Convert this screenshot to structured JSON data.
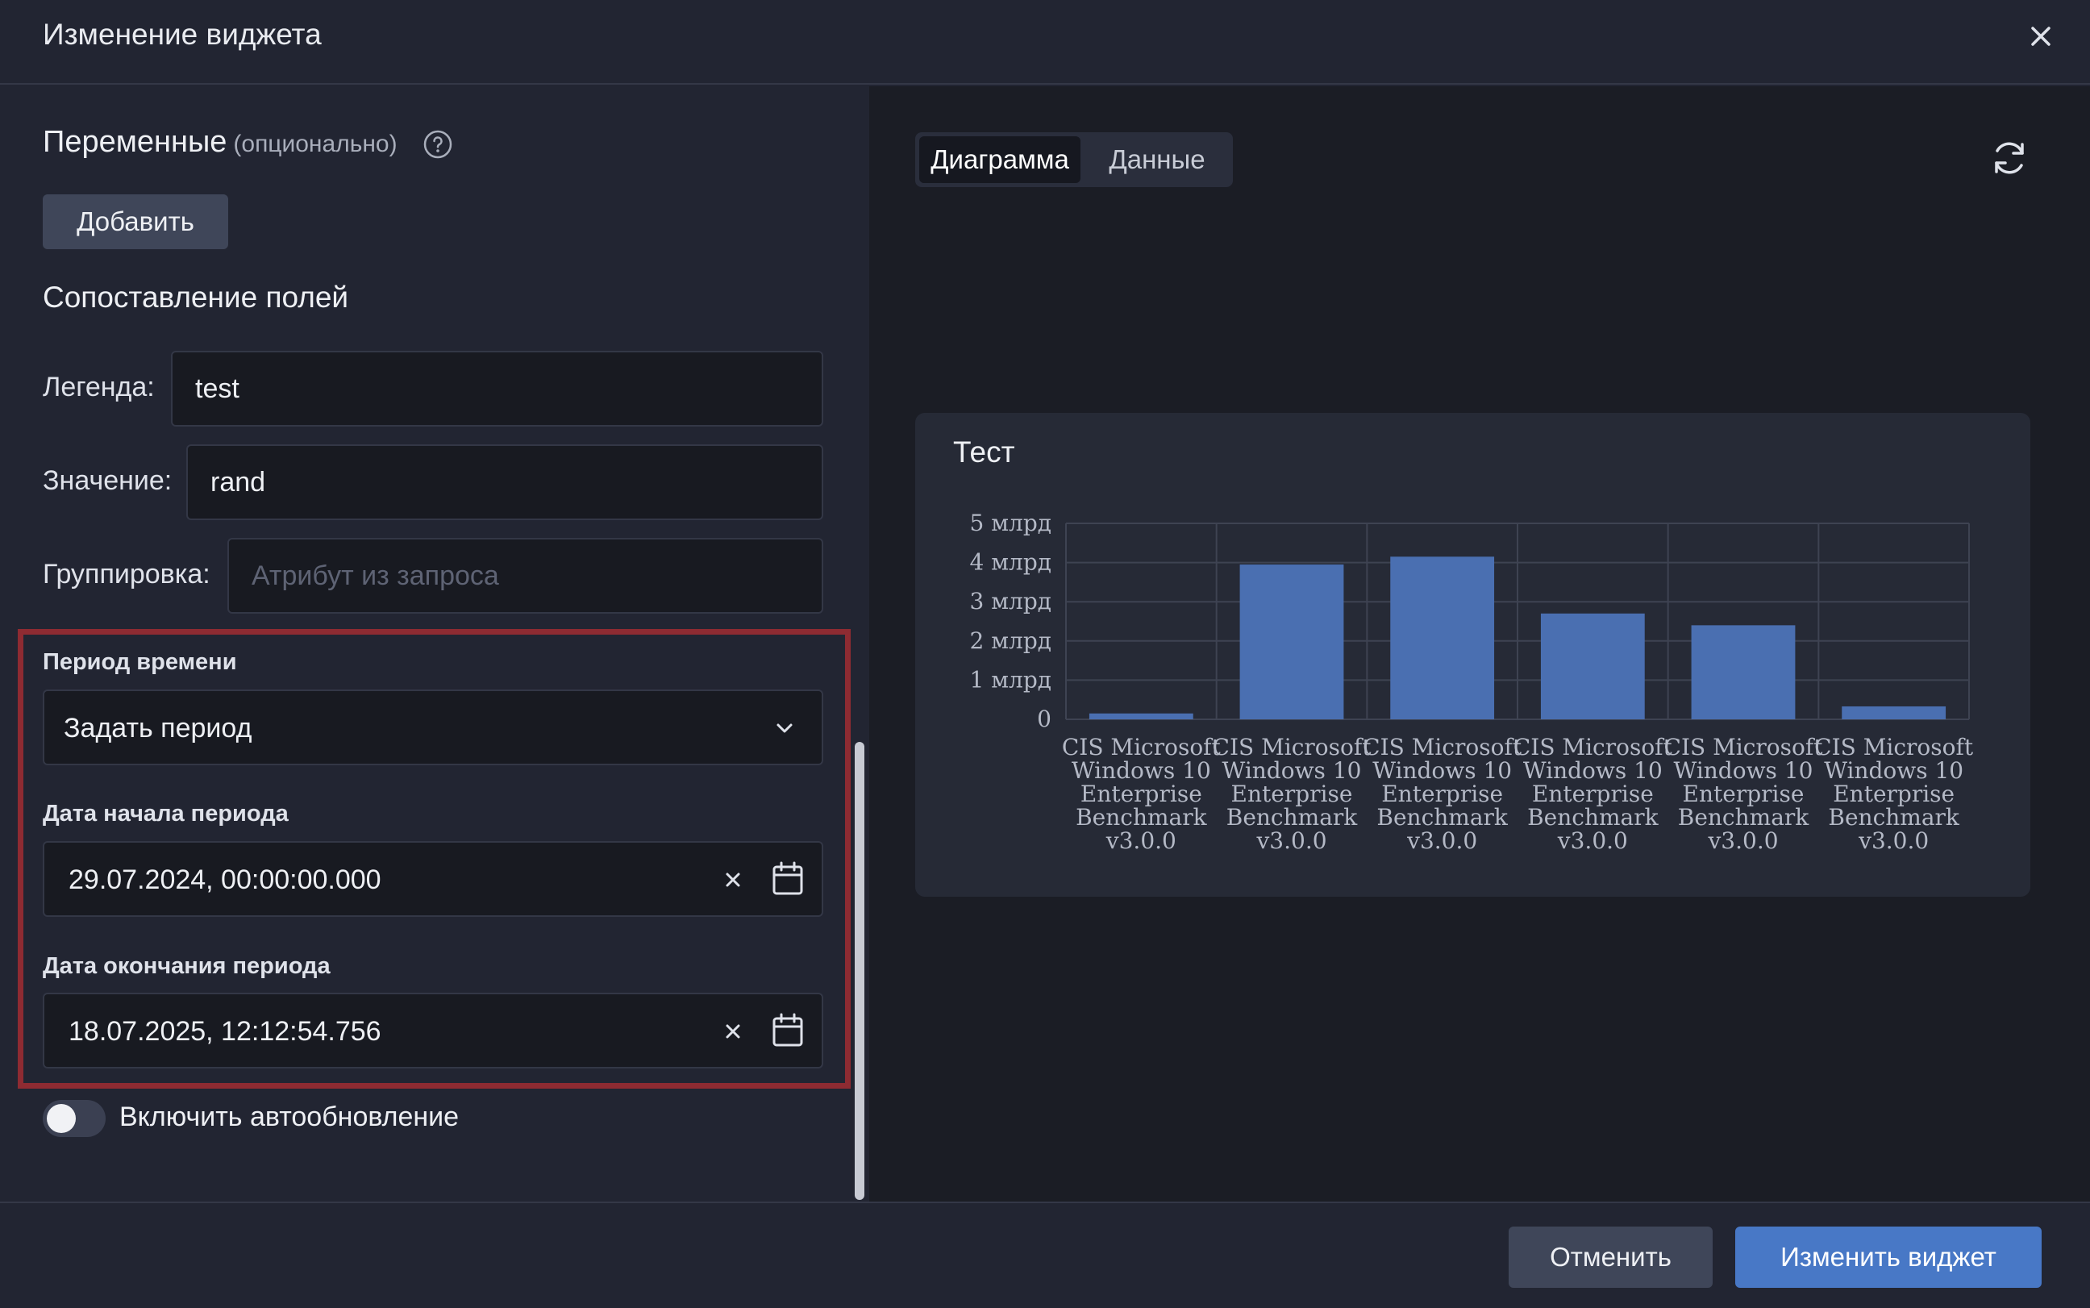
{
  "dialog": {
    "title": "Изменение виджета"
  },
  "variables": {
    "title": "Переменные",
    "optional": "(опционально)",
    "add_button": "Добавить"
  },
  "mapping": {
    "title": "Сопоставление полей",
    "legend_label": "Легенда:",
    "legend_value": "test",
    "value_label": "Значение:",
    "value_value": "rand",
    "grouping_label": "Группировка:",
    "grouping_placeholder": "Атрибут из запроса"
  },
  "period": {
    "label": "Период времени",
    "selected": "Задать период",
    "start_label": "Дата начала периода",
    "start_value": "29.07.2024, 00:00:00.000",
    "end_label": "Дата окончания периода",
    "end_value": "18.07.2025, 12:12:54.756"
  },
  "autorefresh": {
    "label": "Включить автообновление",
    "enabled": false
  },
  "preview": {
    "tabs": [
      "Диаграмма",
      "Данные"
    ],
    "active_tab": "Диаграмма"
  },
  "chart_data": {
    "type": "bar",
    "title": "Тест",
    "categories": [
      "CIS Microsoft Windows 10 Enterprise Benchmark v3.0.0",
      "CIS Microsoft Windows 10 Enterprise Benchmark v3.0.0",
      "CIS Microsoft Windows 10 Enterprise Benchmark v3.0.0",
      "CIS Microsoft Windows 10 Enterprise Benchmark v3.0.0",
      "CIS Microsoft Windows 10 Enterprise Benchmark v3.0.0",
      "CIS Microsoft Windows 10 Enterprise Benchmark v3.0.0"
    ],
    "category_label_lines": [
      "CIS Microsoft",
      "Windows 10",
      "Enterprise",
      "Benchmark",
      "v3.0.0"
    ],
    "values": [
      150000000,
      3950000000,
      4150000000,
      2700000000,
      2400000000,
      330000000
    ],
    "y_ticks": [
      0,
      1000000000,
      2000000000,
      3000000000,
      4000000000,
      5000000000
    ],
    "y_tick_labels": [
      "0",
      "1 млрд",
      "2 млрд",
      "3 млрд",
      "4 млрд",
      "5 млрд"
    ],
    "ylim": [
      0,
      5000000000
    ],
    "grid": true,
    "bar_color": "#4a6fb1"
  },
  "footer": {
    "cancel": "Отменить",
    "submit": "Изменить виджет"
  },
  "colors": {
    "accent": "#4878c6",
    "highlight": "#8e2b32"
  }
}
